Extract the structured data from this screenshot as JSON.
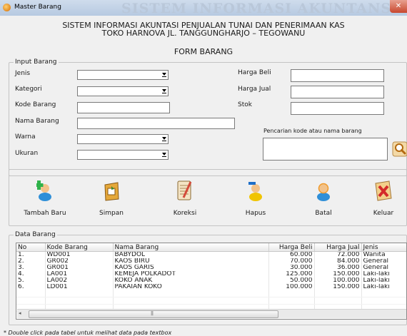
{
  "window": {
    "title": "Master Barang",
    "watermark": "SISTEM INFORMASI AKUNTANSI",
    "close": "✕"
  },
  "header": {
    "line1": "SISTEM INFORMASI AKUNTASI PENJUALAN TUNAI DAN PENERIMAAN KAS",
    "line2": "TOKO HARNOVA JL. TANGGUNGHARJO – TEGOWANU",
    "form_title": "FORM BARANG"
  },
  "input_group": {
    "title": "Input Barang",
    "jenis": "Jenis",
    "kategori": "Kategori",
    "kode_barang": "Kode Barang",
    "nama_barang": "Nama Barang",
    "warna": "Warna",
    "ukuran": "Ukuran",
    "harga_beli": "Harga Beli",
    "harga_jual": "Harga Jual",
    "stok": "Stok",
    "search_label": "Pencarian kode atau nama barang"
  },
  "toolbar": {
    "tambah": "Tambah Baru",
    "simpan": "Simpan",
    "koreksi": "Koreksi",
    "hapus": "Hapus",
    "batal": "Batal",
    "keluar": "Keluar"
  },
  "data_group": {
    "title": "Data Barang",
    "columns": [
      "No",
      "Kode Barang",
      "Nama Barang",
      "Harga Beli",
      "Harga Jual",
      "Jenis"
    ],
    "rows": [
      [
        "1.",
        "WD001",
        "BABYDOL",
        "60.000",
        "72.000",
        "Wanita"
      ],
      [
        "2.",
        "GR002",
        "KAOS BIRU",
        "70.000",
        "84.000",
        "General"
      ],
      [
        "3.",
        "GR001",
        "KAOS GARIS",
        "30.000",
        "36.000",
        "General"
      ],
      [
        "4.",
        "LA001",
        "KEMEJA POLKADOT",
        "125.000",
        "150.000",
        "Laki-laki"
      ],
      [
        "5.",
        "LA002",
        "KOKO ANAK",
        "50.000",
        "100.000",
        "Laki-laki"
      ],
      [
        "6.",
        "LD001",
        "PAKAIAN KOKO",
        "100.000",
        "150.000",
        "Laki-laki"
      ]
    ],
    "scroll_left": "◂",
    "scroll_grip": "|||"
  },
  "footnote": "* Double click pada tabel untuk melihat data pada textbox"
}
